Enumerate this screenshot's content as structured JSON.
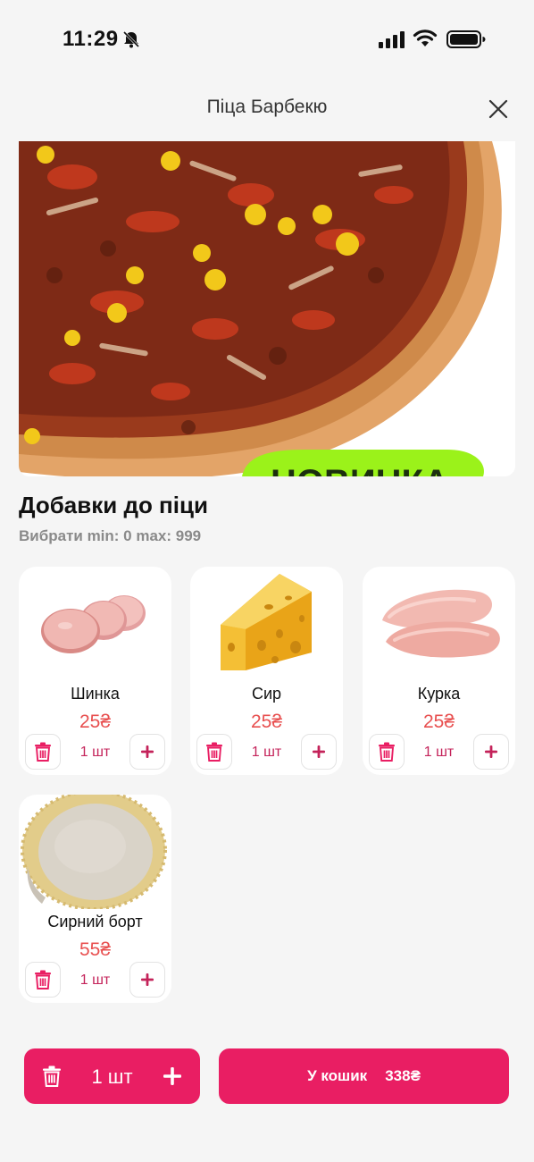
{
  "status_bar": {
    "time": "11:29"
  },
  "header": {
    "title": "Піца Барбекю"
  },
  "hero": {
    "badge_text": "НОВИНКА"
  },
  "section": {
    "title": "Добавки до піци",
    "subtitle": "Вибрати min: 0 max: 999"
  },
  "addons": [
    {
      "name": "Шинка",
      "price": "25₴",
      "qty": "1 шт"
    },
    {
      "name": "Сир",
      "price": "25₴",
      "qty": "1 шт"
    },
    {
      "name": "Курка",
      "price": "25₴",
      "qty": "1 шт"
    },
    {
      "name": "Сирний борт",
      "price": "55₴",
      "qty": "1 шт"
    }
  ],
  "bottom_bar": {
    "qty": "1 шт",
    "cart_label": "У кошик",
    "total": "338₴"
  },
  "colors": {
    "accent": "#e91e63",
    "price": "#e85050",
    "qty_text": "#c4235a"
  }
}
